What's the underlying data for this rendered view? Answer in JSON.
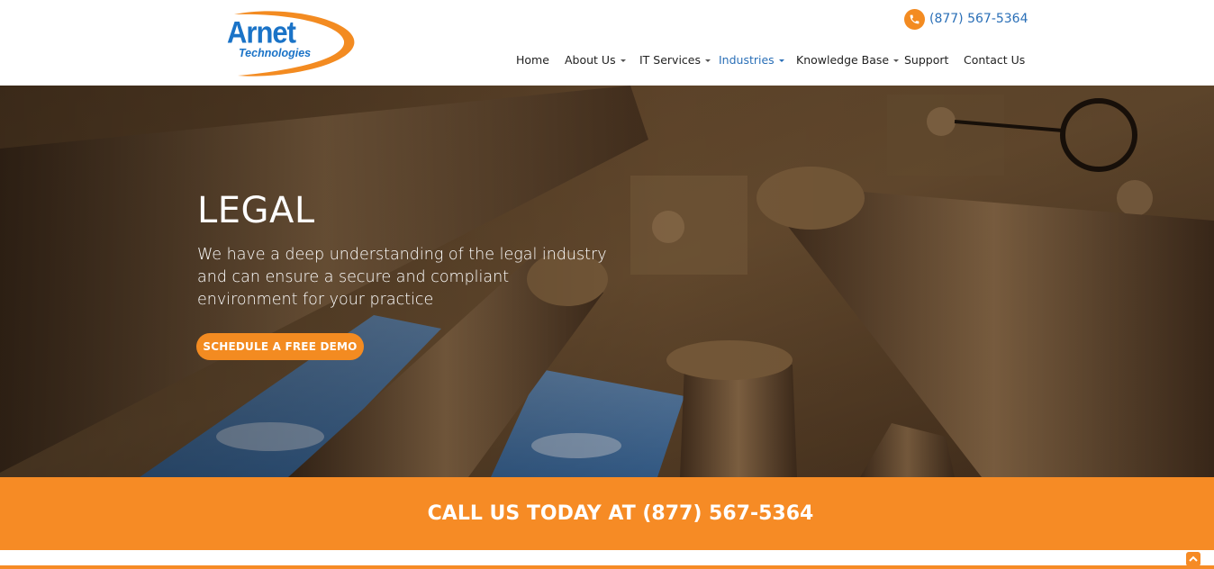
{
  "header": {
    "logo": {
      "line1": "Arnet",
      "line2": "Technologies"
    },
    "phone": {
      "icon": "phone-icon",
      "text": "(877) 567-5364"
    },
    "nav": [
      {
        "label": "Home",
        "dropdown": false,
        "active": false
      },
      {
        "label": "About Us",
        "dropdown": true,
        "active": false
      },
      {
        "label": "IT Services",
        "dropdown": true,
        "active": false
      },
      {
        "label": "Industries",
        "dropdown": true,
        "active": true
      },
      {
        "label": "Knowledge Base",
        "dropdown": true,
        "active": false
      },
      {
        "label": "Support",
        "dropdown": false,
        "active": false
      },
      {
        "label": "Contact Us",
        "dropdown": false,
        "active": false
      }
    ]
  },
  "hero": {
    "title": "LEGAL",
    "description": "We have a deep understanding of the legal industry and can ensure a secure and compliant environment for your practice",
    "button_label": "SCHEDULE A FREE DEMO"
  },
  "cta": {
    "text": "CALL US TODAY AT (877) 567-5364"
  },
  "scroll_top": {
    "icon": "chevron-up-icon"
  },
  "colors": {
    "accent": "#f68b25",
    "brand_blue": "#1a73c7",
    "link_blue": "#2a6fb7"
  }
}
